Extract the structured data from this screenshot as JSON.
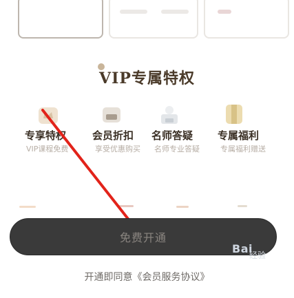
{
  "section": {
    "title": "VIP专属特权"
  },
  "privileges": [
    {
      "label": "专享特权",
      "sub": "VIP课程免费",
      "icon": "crown-icon",
      "color": "#e6d6c2"
    },
    {
      "label": "会员折扣",
      "sub": "享受优惠购买",
      "icon": "discount-tag-icon",
      "color": "#d2cbc2"
    },
    {
      "label": "名师答疑",
      "sub": "名师专业答疑",
      "icon": "teacher-icon",
      "color": "#dadde0"
    },
    {
      "label": "专属福利",
      "sub": "专属福利赠送",
      "icon": "gift-icon",
      "color": "#e8d7a8"
    }
  ],
  "cta": {
    "label": "免费开通"
  },
  "agreement": {
    "text": "开通即同意《会员服务协议》"
  },
  "watermark": {
    "brand": "Bai",
    "small": "经验"
  }
}
